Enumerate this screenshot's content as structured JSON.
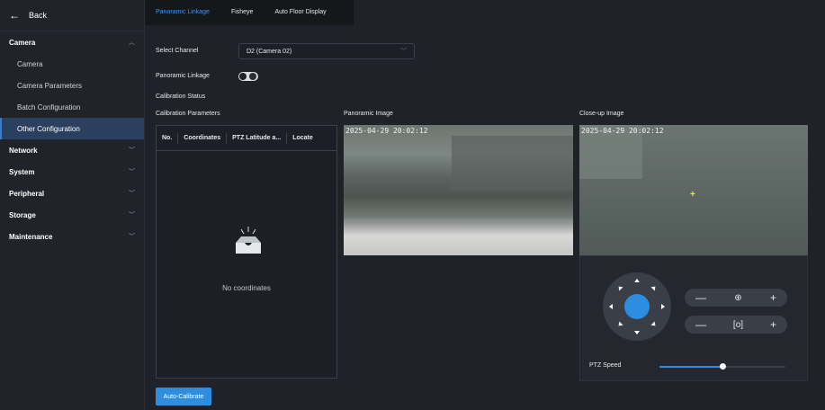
{
  "sidebar": {
    "back_label": "Back",
    "groups": [
      {
        "label": "Camera",
        "expanded": true,
        "items": [
          "Camera",
          "Camera Parameters",
          "Batch Configuration",
          "Other Configuration"
        ],
        "active_item": "Other Configuration"
      },
      {
        "label": "Network",
        "expanded": false
      },
      {
        "label": "System",
        "expanded": false
      },
      {
        "label": "Peripheral",
        "expanded": false
      },
      {
        "label": "Storage",
        "expanded": false
      },
      {
        "label": "Maintenance",
        "expanded": false
      }
    ]
  },
  "tabs": [
    {
      "label": "Panoramic Linkage",
      "active": true
    },
    {
      "label": "Fisheye",
      "active": false
    },
    {
      "label": "Auto Floor Display",
      "active": false
    }
  ],
  "form": {
    "select_channel_label": "Select Channel",
    "select_channel_value": "D2 (Camera 02)",
    "panoramic_linkage_label": "Panoramic Linkage",
    "panoramic_linkage_on": false,
    "calibration_status_label": "Calibration Status",
    "calibration_parameters_label": "Calibration Parameters"
  },
  "calibration_table": {
    "columns": [
      "No.",
      "Coordinates",
      "PTZ Latitude a...",
      "Locate"
    ],
    "rows": [],
    "empty_text": "No coordinates"
  },
  "panoramic": {
    "label": "Panoramic Image",
    "timestamp": "2025-04-29 20:02:12"
  },
  "closeup": {
    "label": "Close-up Image",
    "timestamp": "2025-04-29 20:02:12"
  },
  "ptz": {
    "speed_label": "PTZ Speed",
    "speed_fraction": 0.5,
    "zoom": {
      "minus": "—",
      "icon": "⊕",
      "plus": "+"
    },
    "focus": {
      "minus": "—",
      "icon": "[o]",
      "plus": "+"
    }
  },
  "buttons": {
    "auto_calibrate": "Auto-Calibrate"
  },
  "colors": {
    "accent": "#2d8ee0",
    "active_nav": "#2b3f5e",
    "crosshair": "#f6e514"
  }
}
